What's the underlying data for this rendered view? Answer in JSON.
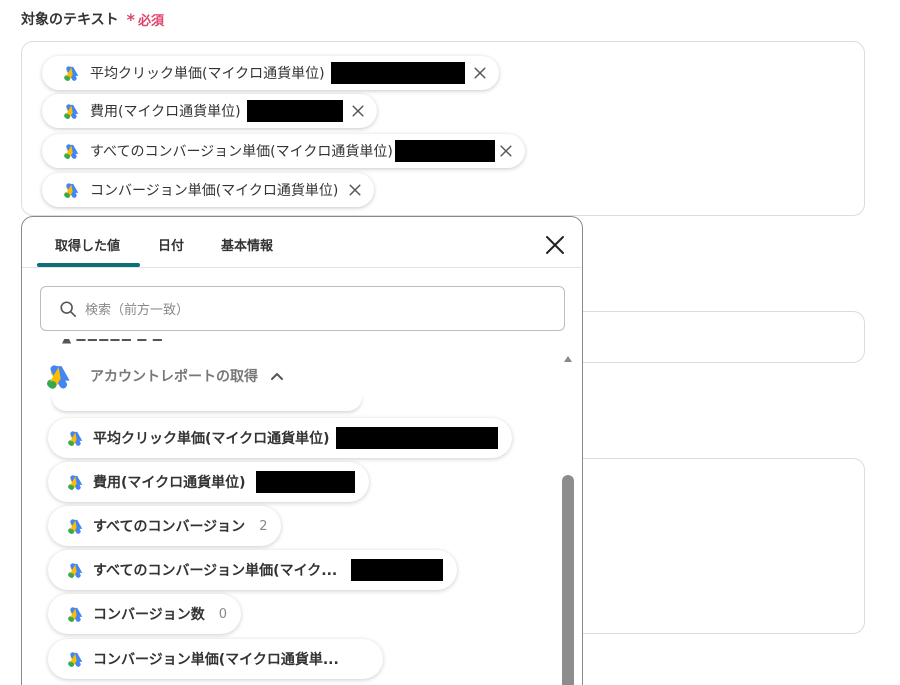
{
  "field": {
    "label": "対象のテキスト",
    "required_mark": "必須",
    "chips": [
      {
        "label": "平均クリック単価(マイクロ通貨単位)",
        "icon": "google-ads-icon"
      },
      {
        "label": "費用(マイクロ通貨単位)",
        "icon": "google-ads-icon"
      },
      {
        "label": "すべてのコンバージョン単価(マイクロ通貨単位)",
        "icon": "google-ads-icon"
      },
      {
        "label": "コンバージョン単価(マイクロ通貨単位)",
        "icon": "google-ads-icon"
      }
    ]
  },
  "popup": {
    "tabs": [
      {
        "label": "取得した値",
        "active": true
      },
      {
        "label": "日付",
        "active": false
      },
      {
        "label": "基本情報",
        "active": false
      }
    ],
    "search_placeholder": "検索（前方一致）",
    "group": {
      "title": "アカウントレポートの取得",
      "items": [
        {
          "label": "平均クリック単価(マイクロ通貨単位)"
        },
        {
          "label": "費用(マイクロ通貨単位)"
        },
        {
          "label": "すべてのコンバージョン",
          "value": "2"
        },
        {
          "label": "すべてのコンバージョン単価(マイク..."
        },
        {
          "label": "コンバージョン数",
          "value": "0"
        },
        {
          "label": "コンバージョン単価(マイクロ通貨単..."
        }
      ]
    }
  },
  "colors": {
    "accent": "#0e6e7e",
    "required": "#e0446a",
    "google_blue": "#4285F4",
    "google_yellow": "#FBBC04",
    "google_green": "#34A853"
  }
}
